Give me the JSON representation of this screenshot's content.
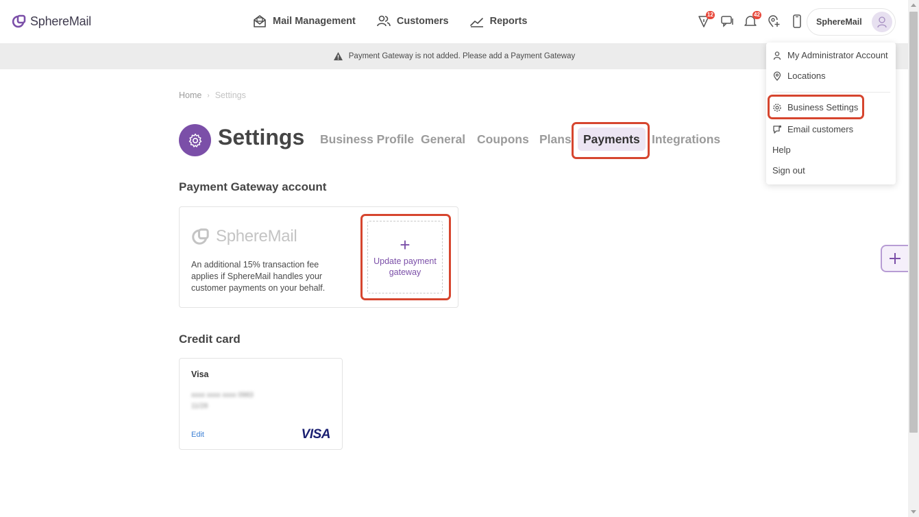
{
  "header": {
    "brand": "SphereMail",
    "nav": [
      {
        "label": "Mail Management",
        "icon": "mail-envelope-icon"
      },
      {
        "label": "Customers",
        "icon": "users-icon"
      },
      {
        "label": "Reports",
        "icon": "chart-line-icon"
      }
    ],
    "badges": {
      "alerts": "12",
      "notifications": "42"
    },
    "profile_name": "SphereMail"
  },
  "banner": {
    "text": "Payment Gateway is not added. Please add a  Payment Gateway"
  },
  "breadcrumb": {
    "home": "Home",
    "current": "Settings"
  },
  "page": {
    "title": "Settings",
    "tabs": [
      "Business Profile",
      "General",
      "Coupons",
      "Plans",
      "Payments",
      "Integrations"
    ],
    "active_tab": "Payments"
  },
  "payment_gateway": {
    "section_title": "Payment Gateway account",
    "logo_text": "SphereMail",
    "description": "An additional 15% transaction fee applies if SphereMail handles your customer payments on your behalf.",
    "update_label": "Update payment gateway"
  },
  "credit_card": {
    "section_title": "Credit card",
    "brand": "Visa",
    "masked_number": "xxxx xxxx xxxx 0983",
    "expiry": "11/28",
    "edit_label": "Edit",
    "network_logo": "VISA"
  },
  "dropdown": {
    "items": [
      "My Administrator Account",
      "Locations",
      "Business Settings",
      "Email customers",
      "Help",
      "Sign out"
    ]
  },
  "colors": {
    "accent": "#7b4fa8",
    "highlight": "#d6452e",
    "badge": "#e8493c"
  }
}
